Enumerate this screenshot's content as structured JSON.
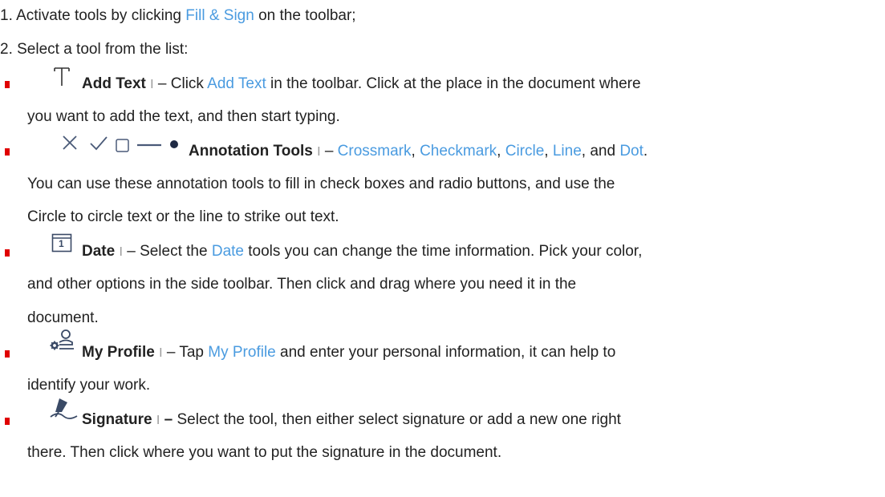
{
  "colors": {
    "link": "#4a9be0",
    "bullet": "#e00000",
    "text": "#222222"
  },
  "steps": [
    {
      "pre": "1.  Activate tools by clicking ",
      "link": "Fill & Sign",
      "post": " on the toolbar;"
    },
    {
      "text": "2.  Select a tool from the list:"
    }
  ],
  "separator": "I",
  "dash": "–",
  "dash_bold": "–",
  "items": {
    "add_text": {
      "icon": "text-tool-icon",
      "title": "Add Text",
      "pre": "Click ",
      "link": "Add Text",
      "post": " in the toolbar. Click at the place in the document where",
      "line2": "you want to add the text, and then start typing."
    },
    "annotation": {
      "icons": [
        "crossmark-icon",
        "checkmark-icon",
        "square-icon",
        "line-icon",
        "dot-icon"
      ],
      "title": "Annotation Tools",
      "links": [
        "Crossmark",
        "Checkmark",
        "Circle",
        "Line",
        "Dot"
      ],
      "comma": ", ",
      "and": ", and ",
      "period": ".",
      "line2": "You can use these annotation tools to fill in check boxes and radio buttons, and use the",
      "line3": "Circle to circle text or the line to strike out text."
    },
    "date": {
      "icon": "calendar-icon",
      "icon_digit": "1",
      "title": "Date",
      "pre": "Select the ",
      "link": "Date",
      "post": " tools you can change the time information. Pick your color,",
      "line2": "and other options in the side toolbar. Then click and drag where you need it in the",
      "line3": "document."
    },
    "profile": {
      "icon": "profile-icon",
      "title": "My Profile",
      "pre": "Tap ",
      "link": "My Profile",
      "post": " and enter your personal information, it can help to",
      "line2": "identify your work."
    },
    "signature": {
      "icon": "pen-signature-icon",
      "title": "Signature",
      "text": "Select the tool, then either select signature or add a new one right",
      "line2": "there. Then click where you want to put the signature in the document."
    }
  }
}
